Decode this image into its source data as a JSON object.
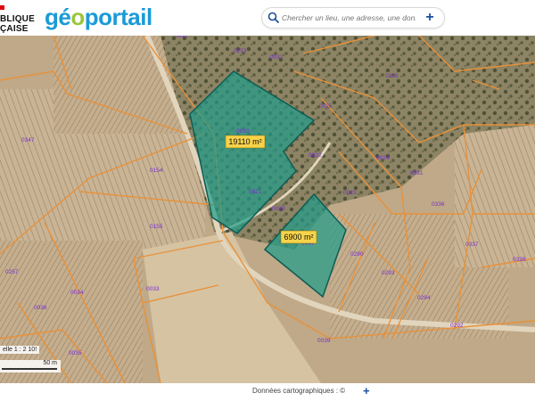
{
  "header": {
    "republic_line1": "BLIQUE",
    "republic_line2": "ÇAISE",
    "brand_prefix": "gé",
    "brand_o": "o",
    "brand_suffix": "portail"
  },
  "search": {
    "placeholder": "Chercher un lieu, une adresse, une donnée",
    "plus_label": "+"
  },
  "map": {
    "area_labels": [
      {
        "id": "area-1",
        "text": "19110 m²"
      },
      {
        "id": "area-2",
        "text": "6900 m²"
      }
    ],
    "parcel_numbers": [
      "0253",
      "0031",
      "0026",
      "0025",
      "0033",
      "0347",
      "0154",
      "0022",
      "0024",
      "0331",
      "0021",
      "0023",
      "0029",
      "0336",
      "0028",
      "0290",
      "0337",
      "0155",
      "0338",
      "0293",
      "0257",
      "0033",
      "0034",
      "0294",
      "0036",
      "0292",
      "0039",
      "0035",
      "0018",
      "0047"
    ]
  },
  "scale": {
    "ratio_text": "elle 1 : 2 10!",
    "distance_text": "50 m"
  },
  "footer": {
    "credits": "Données cartographiques : ©",
    "plus_label": "+"
  },
  "colors": {
    "parcel_border": "#e8913a",
    "parcel_number": "#7a2fd0",
    "measure_fill": "#1f9c8a",
    "label_bg": "#f7d34a",
    "brand_blue": "#1a9bd7",
    "brand_green": "#9dc53b"
  }
}
